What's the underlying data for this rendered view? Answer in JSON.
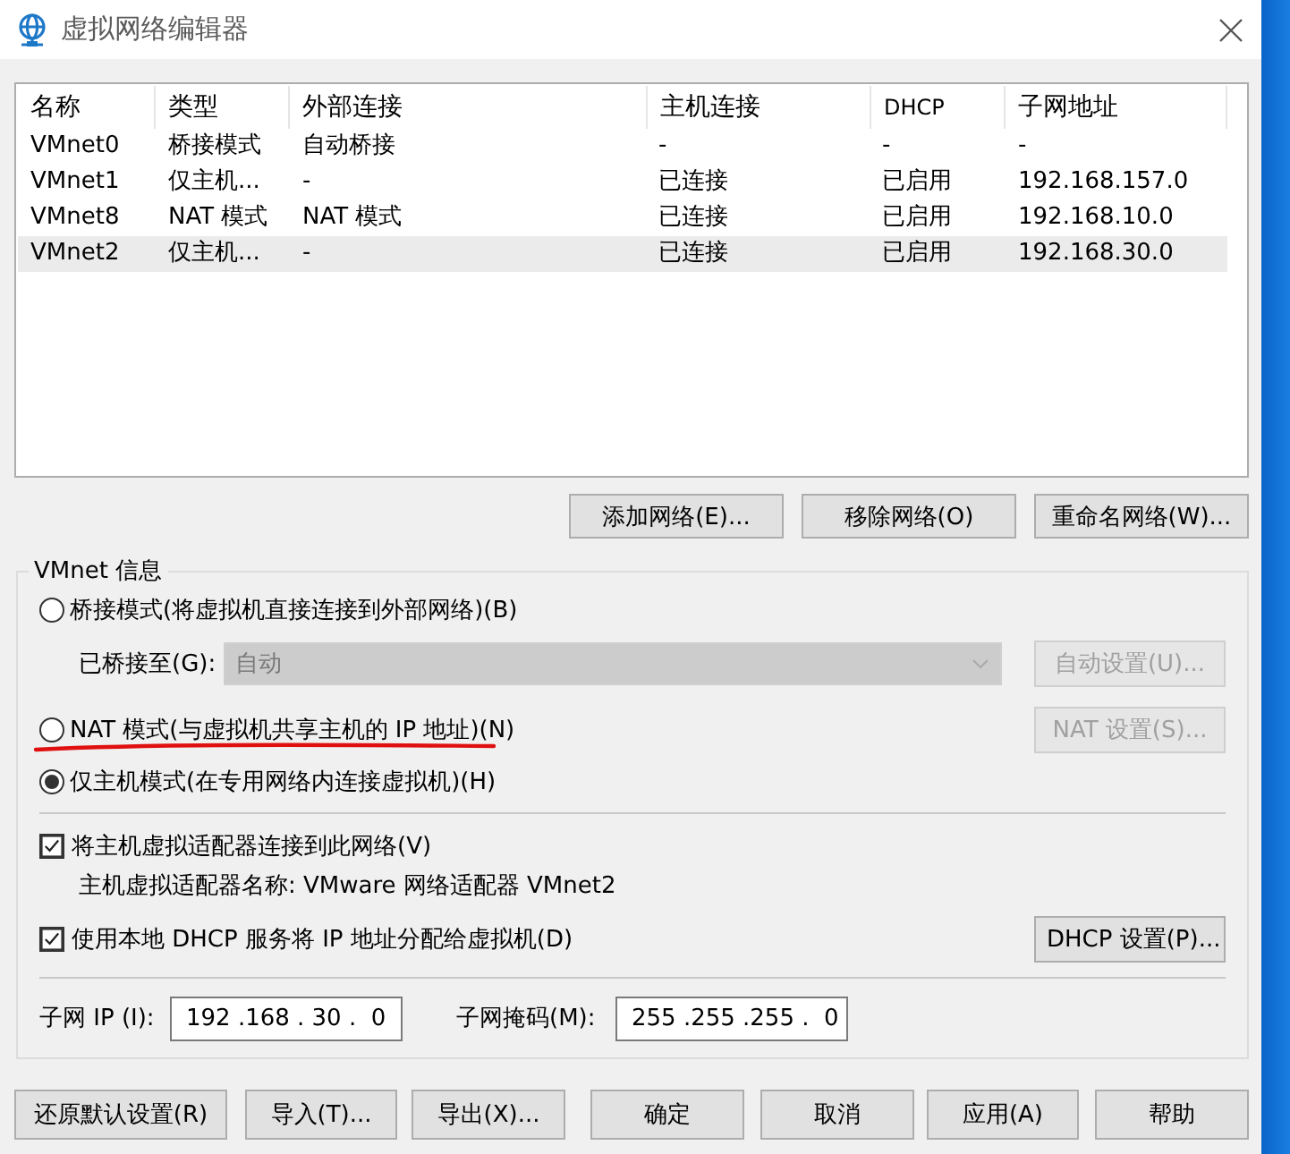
{
  "window": {
    "title": "虚拟网络编辑器"
  },
  "table": {
    "columns": [
      "名称",
      "类型",
      "外部连接",
      "主机连接",
      "DHCP",
      "子网地址"
    ],
    "rows": [
      {
        "cells": [
          "VMnet0",
          "桥接模式",
          "自动桥接",
          "-",
          "-",
          "-"
        ],
        "selected": false
      },
      {
        "cells": [
          "VMnet1",
          "仅主机...",
          "-",
          "已连接",
          "已启用",
          "192.168.157.0"
        ],
        "selected": false
      },
      {
        "cells": [
          "VMnet8",
          "NAT 模式",
          "NAT 模式",
          "已连接",
          "已启用",
          "192.168.10.0"
        ],
        "selected": false
      },
      {
        "cells": [
          "VMnet2",
          "仅主机...",
          "-",
          "已连接",
          "已启用",
          "192.168.30.0"
        ],
        "selected": true
      }
    ]
  },
  "network_buttons": [
    {
      "label": "添加网络(E)..."
    },
    {
      "label": "移除网络(O)"
    },
    {
      "label": "重命名网络(W)..."
    }
  ],
  "vmnet_info": {
    "title": "VMnet 信息",
    "modes": [
      {
        "kind": "bridged",
        "label": "桥接模式(将虚拟机直接连接到外部网络)(B)",
        "selected": false,
        "underlined": false
      },
      {
        "kind": "nat",
        "label": "NAT 模式(与虚拟机共享主机的 IP 地址)(N)",
        "selected": false,
        "underlined": true
      },
      {
        "kind": "host_only",
        "label": "仅主机模式(在专用网络内连接虚拟机)(H)",
        "selected": true,
        "underlined": false
      }
    ],
    "bridged_to": {
      "label": "已桥接至(G):",
      "value": "自动",
      "disabled": true
    },
    "auto_settings_button": {
      "label": "自动设置(U)...",
      "disabled": true
    },
    "nat_settings_button": {
      "label": "NAT 设置(S)...",
      "disabled": true
    },
    "connect_adapter": {
      "label": "将主机虚拟适配器连接到此网络(V)",
      "checked": true
    },
    "adapter_name": "主机虚拟适配器名称: VMware 网络适配器 VMnet2",
    "use_dhcp": {
      "label": "使用本地 DHCP 服务将 IP 地址分配给虚拟机(D)",
      "checked": true
    },
    "dhcp_settings_button": {
      "label": "DHCP 设置(P)...",
      "disabled": false
    },
    "subnet_ip": {
      "label": "子网 IP (I):",
      "value": "192 .168 . 30 .  0"
    },
    "subnet_mask": {
      "label": "子网掩码(M):",
      "value": "255 .255 .255 .  0"
    }
  },
  "footer_buttons": [
    {
      "label": "还原默认设置(R)"
    },
    {
      "label": "导入(T)..."
    },
    {
      "label": "导出(X)..."
    },
    {
      "label": "确定"
    },
    {
      "label": "取消"
    },
    {
      "label": "应用(A)"
    },
    {
      "label": "帮助"
    }
  ]
}
